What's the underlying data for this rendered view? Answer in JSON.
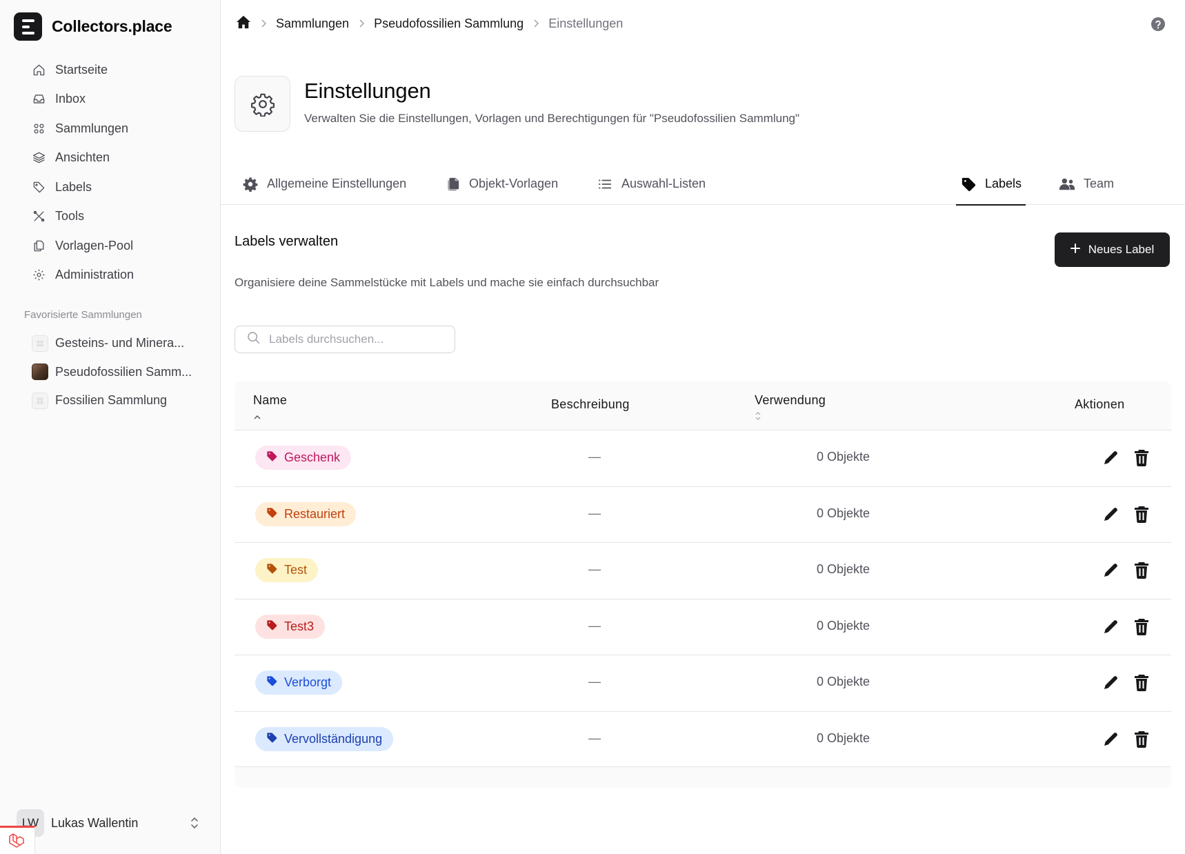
{
  "app": {
    "name": "Collectors.place"
  },
  "sidebar": {
    "nav": [
      {
        "label": "Startseite",
        "icon": "home-icon"
      },
      {
        "label": "Inbox",
        "icon": "inbox-icon"
      },
      {
        "label": "Sammlungen",
        "icon": "grid-icon"
      },
      {
        "label": "Ansichten",
        "icon": "layers-icon"
      },
      {
        "label": "Labels",
        "icon": "tag-icon"
      },
      {
        "label": "Tools",
        "icon": "tools-icon"
      },
      {
        "label": "Vorlagen-Pool",
        "icon": "copy-icon"
      },
      {
        "label": "Administration",
        "icon": "gear-icon"
      }
    ],
    "favorites_title": "Favorisierte Sammlungen",
    "favorites": [
      {
        "label": "Gesteins- und Minera..."
      },
      {
        "label": "Pseudofossilien Samm..."
      },
      {
        "label": "Fossilien Sammlung"
      }
    ],
    "user": {
      "initials": "LW",
      "name": "Lukas Wallentin"
    }
  },
  "breadcrumb": {
    "items": [
      "Sammlungen",
      "Pseudofossilien Sammlung"
    ],
    "current": "Einstellungen"
  },
  "header": {
    "title": "Einstellungen",
    "subtitle": "Verwalten Sie die Einstellungen, Vorlagen und Berechtigungen für \"Pseudofossilien Sammlung\""
  },
  "tabs": [
    {
      "label": "Allgemeine Einstellungen",
      "icon": "gear-icon"
    },
    {
      "label": "Objekt-Vorlagen",
      "icon": "templates-icon"
    },
    {
      "label": "Auswahl-Listen",
      "icon": "list-icon"
    },
    {
      "label": "Labels",
      "icon": "tag-icon",
      "active": true
    },
    {
      "label": "Team",
      "icon": "users-icon"
    }
  ],
  "section": {
    "title": "Labels verwalten",
    "description": "Organisiere deine Sammelstücke mit Labels und mache sie einfach durchsuchbar",
    "new_button": "Neues Label"
  },
  "search": {
    "placeholder": "Labels durchsuchen..."
  },
  "table": {
    "columns": {
      "name": "Name",
      "description": "Beschreibung",
      "usage": "Verwendung",
      "actions": "Aktionen"
    },
    "rows": [
      {
        "name": "Geschenk",
        "description": "—",
        "usage": "0 Objekte",
        "bg": "#fce7f3",
        "fg": "#be185d"
      },
      {
        "name": "Restauriert",
        "description": "—",
        "usage": "0 Objekte",
        "bg": "#ffedd5",
        "fg": "#c2410c"
      },
      {
        "name": "Test",
        "description": "—",
        "usage": "0 Objekte",
        "bg": "#fef3c7",
        "fg": "#b45309"
      },
      {
        "name": "Test3",
        "description": "—",
        "usage": "0 Objekte",
        "bg": "#fee2e2",
        "fg": "#b91c1c"
      },
      {
        "name": "Verborgt",
        "description": "—",
        "usage": "0 Objekte",
        "bg": "#dbeafe",
        "fg": "#1d4ed8"
      },
      {
        "name": "Vervollständigung",
        "description": "—",
        "usage": "0 Objekte",
        "bg": "#dbeafe",
        "fg": "#1e40af"
      }
    ]
  }
}
